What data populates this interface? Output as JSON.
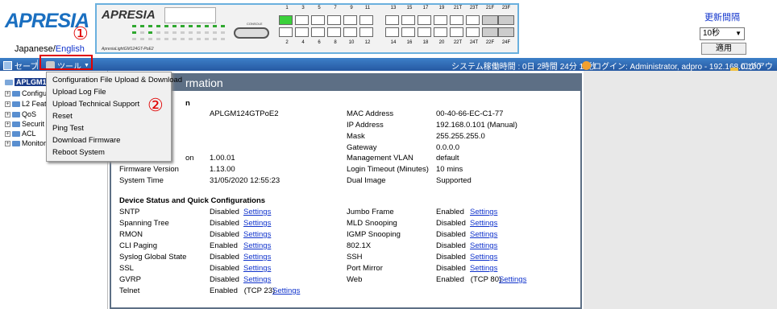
{
  "header": {
    "logo": "APRESIA",
    "lang_japanese": "Japanese/",
    "lang_english": "English",
    "panel_logo": "APRESIA",
    "panel_model": "ApresiaLightGM124GT-PoE2",
    "console_label": "CONSOLE",
    "top_ports": [
      "1",
      "3",
      "5",
      "7",
      "9",
      "11",
      "13",
      "15",
      "17",
      "19",
      "21T",
      "23T",
      "21F",
      "23F"
    ],
    "bottom_ports": [
      "2",
      "4",
      "6",
      "8",
      "10",
      "12",
      "14",
      "16",
      "18",
      "20",
      "22T",
      "24T",
      "22F",
      "24F"
    ],
    "refresh_label": "更新間隔",
    "refresh_value": "10秒",
    "apply_label": "適用"
  },
  "toolbar": {
    "save_label": "セーブ",
    "tools_label": "ツール",
    "system_uptime": "システム稼働時間 : 0日  2時間  24分  18秒",
    "login_info": "ログイン: Administrator, adpro - 192.168.0.100",
    "logout_label": "ログアウト"
  },
  "annotations": {
    "one": "①",
    "two": "②"
  },
  "tools_menu": [
    "Configuration File Upload & Download",
    "Upload Log File",
    "Upload Technical Support",
    "Reset",
    "Ping Test",
    "Download Firmware",
    "Reboot System"
  ],
  "tree": {
    "root": "APLGM1",
    "items": [
      "Configu",
      "L2 Feat",
      "QoS",
      "Securit",
      "ACL",
      "Monitor"
    ]
  },
  "main": {
    "title": "rmation",
    "section1_title": "n",
    "model_value": "APLGM124GTPoE2",
    "boot_label": "on",
    "boot_value": "1.00.01",
    "firmware_label": "Firmware Version",
    "firmware_value": "1.13.00",
    "systime_label": "System Time",
    "systime_value": "31/05/2020 12:55:23",
    "mac_label": "MAC Address",
    "mac_value": "00-40-66-EC-C1-77",
    "ip_label": "IP Address",
    "ip_value": "192.168.0.101 (Manual)",
    "mask_label": "Mask",
    "mask_value": "255.255.255.0",
    "gateway_label": "Gateway",
    "gateway_value": "0.0.0.0",
    "mgmt_vlan_label": "Management VLAN",
    "mgmt_vlan_value": "default",
    "login_timeout_label": "Login Timeout (Minutes)",
    "login_timeout_value": "10 mins",
    "dual_image_label": "Dual Image",
    "dual_image_value": "Supported",
    "section2_title": "Device Status and Quick Configurations",
    "settings_link": "Settings",
    "left_rows": [
      {
        "name": "SNTP",
        "status": "Disabled"
      },
      {
        "name": "Spanning Tree",
        "status": "Disabled"
      },
      {
        "name": "RMON",
        "status": "Disabled"
      },
      {
        "name": "CLI Paging",
        "status": "Enabled"
      },
      {
        "name": "Syslog Global State",
        "status": "Disabled"
      },
      {
        "name": "SSL",
        "status": "Disabled"
      },
      {
        "name": "GVRP",
        "status": "Disabled"
      },
      {
        "name": "Telnet",
        "status": "Enabled   (TCP 23)"
      }
    ],
    "right_rows": [
      {
        "name": "Jumbo Frame",
        "status": "Enabled"
      },
      {
        "name": "MLD Snooping",
        "status": "Disabled"
      },
      {
        "name": "IGMP Snooping",
        "status": "Disabled"
      },
      {
        "name": "802.1X",
        "status": "Disabled"
      },
      {
        "name": "SSH",
        "status": "Disabled"
      },
      {
        "name": "Port Mirror",
        "status": "Disabled"
      },
      {
        "name": "Web",
        "status": "Enabled   (TCP 80)"
      }
    ]
  },
  "colors": {
    "toolbar": "#2f6bb6",
    "annotation": "#e00000",
    "panel_header": "#5d6f85",
    "link": "#1033cc"
  }
}
